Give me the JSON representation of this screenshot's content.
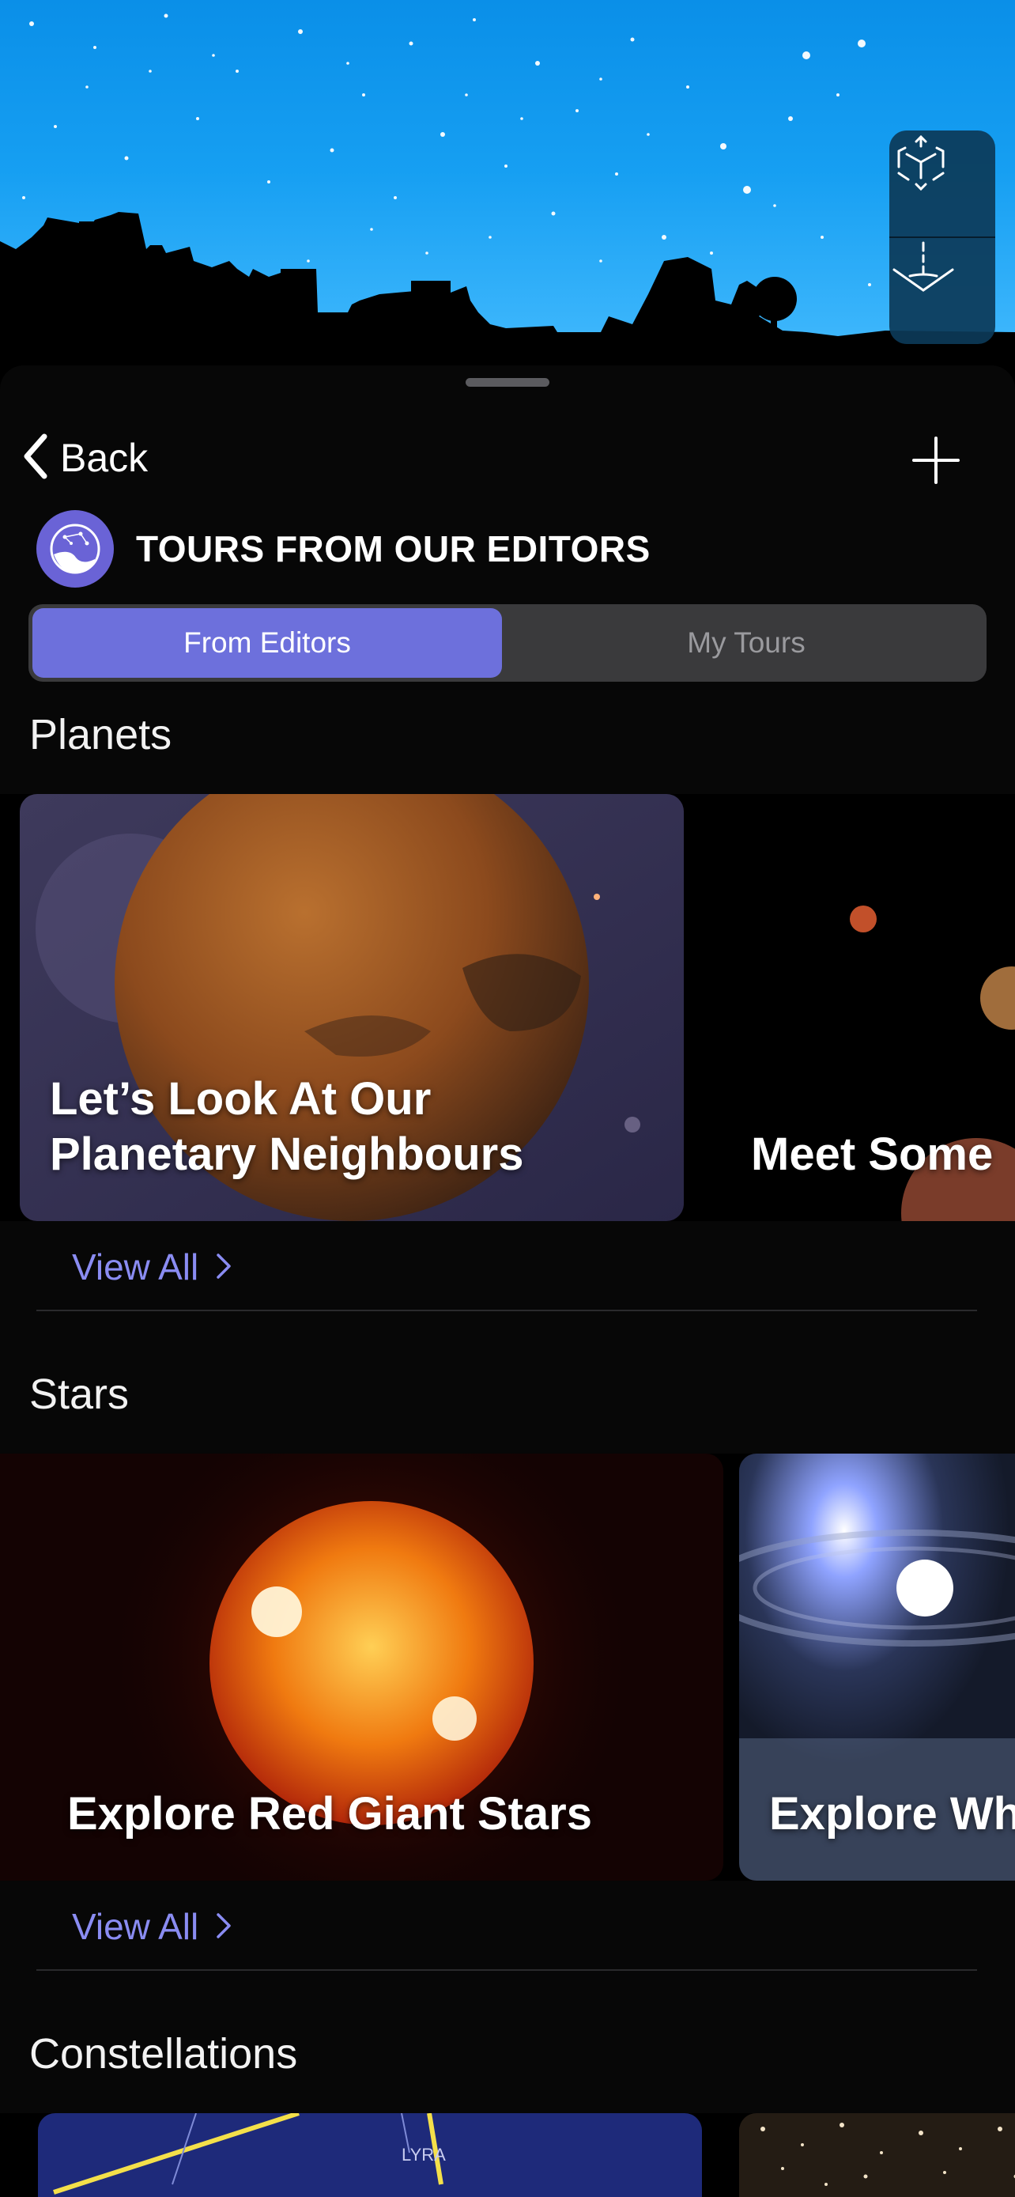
{
  "header": {
    "back_label": "Back",
    "title": "TOURS FROM OUR EDITORS"
  },
  "segments": {
    "active": "From Editors",
    "inactive": "My Tours"
  },
  "sections": [
    {
      "title": "Planets",
      "cards": [
        {
          "title": "Let’s Look At Our\nPlanetary Neighbours"
        },
        {
          "title": "Meet Some"
        }
      ],
      "view_all": "View All"
    },
    {
      "title": "Stars",
      "cards": [
        {
          "title": "Explore Red Giant Stars"
        },
        {
          "title": "Explore Wh"
        }
      ],
      "view_all": "View All"
    },
    {
      "title": "Constellations",
      "cards": [
        {
          "label": "LYRA"
        },
        {
          "label": ""
        }
      ]
    }
  ],
  "colors": {
    "accent": "#6d70dc",
    "link": "#8a8cf2",
    "sky": "#169ff2"
  }
}
